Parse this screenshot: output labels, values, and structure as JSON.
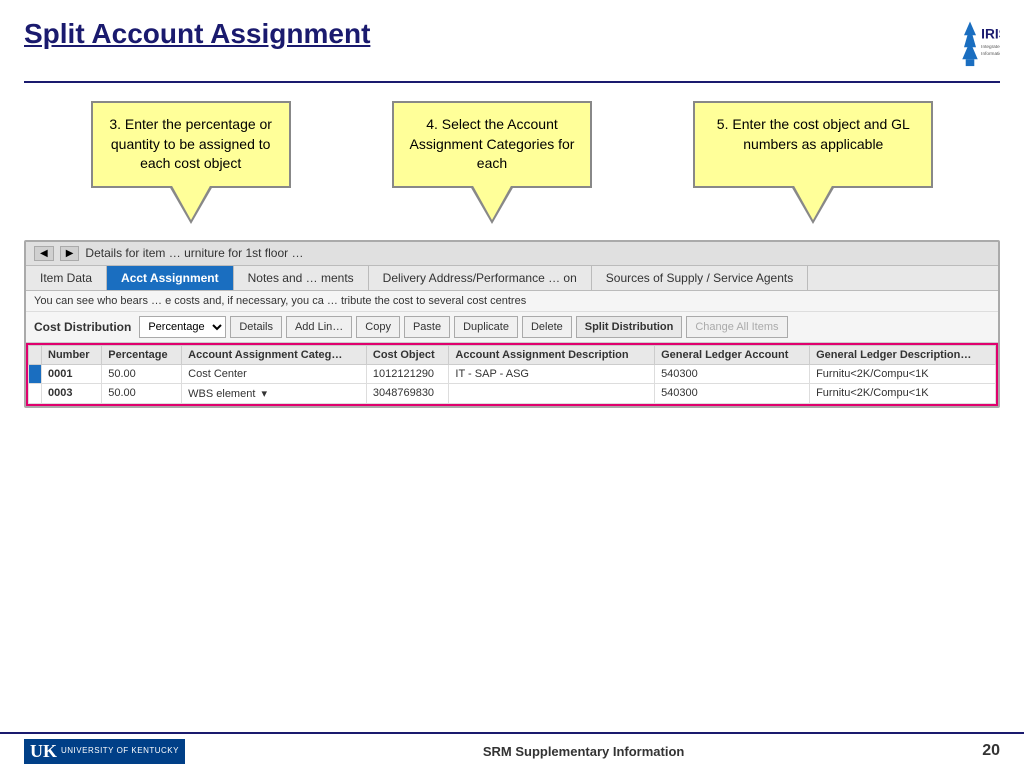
{
  "header": {
    "title": "Split Account Assignment",
    "logo_text": "IRIS",
    "logo_subtitle": "Integrated Resource\nInformation System"
  },
  "callouts": [
    {
      "id": "callout-1",
      "text": "3. Enter the percentage or quantity to be assigned to each cost object"
    },
    {
      "id": "callout-2",
      "text": "4. Select the Account Assignment Categories for each"
    },
    {
      "id": "callout-3",
      "text": "5. Enter the cost object and GL numbers as applicable"
    }
  ],
  "window": {
    "title": "Details for item … urniture for 1st floor …",
    "tabs": [
      {
        "label": "Item Data",
        "active": false
      },
      {
        "label": "Acct Assignment",
        "active": true
      },
      {
        "label": "Notes and … ments",
        "active": false
      },
      {
        "label": "Delivery Address/Performance … on",
        "active": false
      },
      {
        "label": "Sources of Supply / Service Agents",
        "active": false
      }
    ],
    "info_text": "You can see who bears … e costs and, if necessary, you ca … tribute the cost to several cost centres",
    "toolbar": {
      "label": "Cost Distribution",
      "select_value": "Percentage",
      "buttons": [
        "Details",
        "Add Lin…",
        "Copy",
        "Paste",
        "Duplicate",
        "Delete",
        "Split Distribution",
        "Change All Items"
      ]
    },
    "table": {
      "columns": [
        "",
        "Number",
        "Percentage",
        "Account Assignment Categ…",
        "Cost Object",
        "Account Assignment Description",
        "General Ledger Account",
        "General Ledger Description…"
      ],
      "rows": [
        {
          "indicator": true,
          "number": "0001",
          "percentage": "50.00",
          "account_cat": "Cost Center",
          "cost_object": "1012121290",
          "aa_description": "IT - SAP - ASG",
          "gl_account": "540300",
          "gl_description": "Furnitu<2K/Compu<1K"
        },
        {
          "indicator": false,
          "number": "0003",
          "percentage": "50.00",
          "account_cat": "WBS element",
          "cost_object": "3048769830",
          "aa_description": "",
          "gl_account": "540300",
          "gl_description": "Furnitu<2K/Compu<1K"
        }
      ]
    }
  },
  "footer": {
    "uk_label": "UK",
    "university_text": "UNIVERSITY OF KENTUCKY",
    "center_text": "SRM Supplementary Information",
    "page_number": "20"
  }
}
